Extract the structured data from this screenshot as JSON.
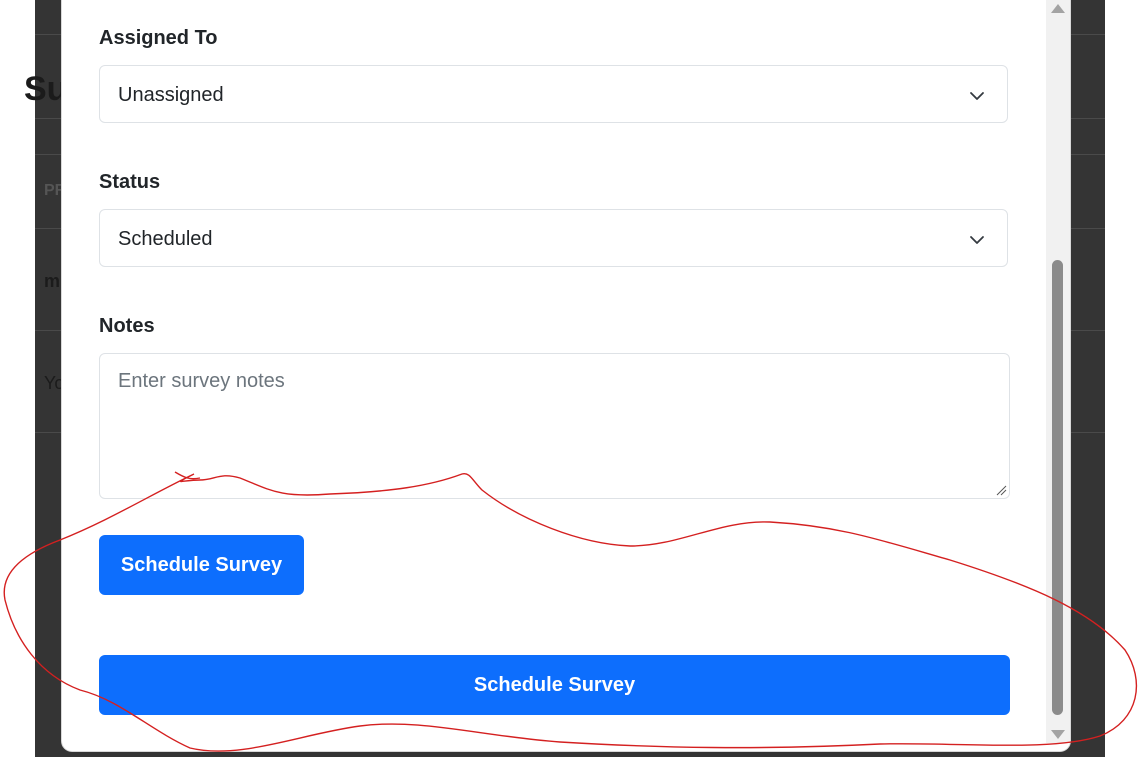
{
  "background": {
    "title_fragment": "Su",
    "header_fragment": "PR",
    "row1_fragment": "m",
    "row2_fragment": "Yo"
  },
  "form": {
    "assigned_to": {
      "label": "Assigned To",
      "value": "Unassigned"
    },
    "status": {
      "label": "Status",
      "value": "Scheduled"
    },
    "notes": {
      "label": "Notes",
      "placeholder": "Enter survey notes"
    }
  },
  "buttons": {
    "schedule_small": "Schedule Survey",
    "schedule_wide": "Schedule Survey"
  },
  "colors": {
    "primary": "#0d6efd",
    "annotation": "#d42020",
    "overlay": "#343434"
  }
}
